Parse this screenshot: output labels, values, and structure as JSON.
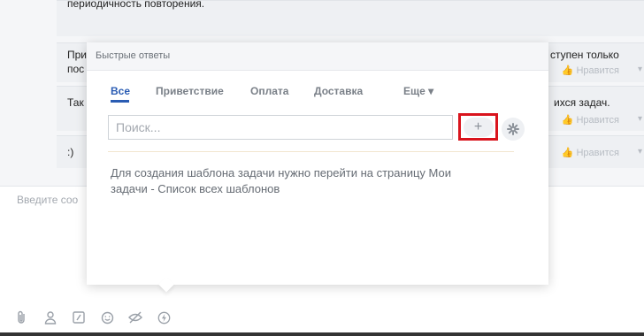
{
  "chat": {
    "msg1_text": "периодичность повторения.",
    "msg2_left": "При",
    "msg2_left2": "пос",
    "msg2_right": "ступен только",
    "msg3_left": "Так",
    "msg3_right": "ихся задач.",
    "msg4_text": ":)",
    "like_label": "Нравится",
    "like_caret": "▾",
    "input_placeholder": "Введите соо"
  },
  "toolbar_icons": [
    "paperclip-icon",
    "person-icon",
    "slash-icon",
    "smile-icon",
    "hidden-eye-icon",
    "lightning-icon"
  ],
  "popup": {
    "title": "Быстрые ответы",
    "tabs": [
      {
        "label": "Все",
        "active": true
      },
      {
        "label": "Приветствие",
        "active": false
      },
      {
        "label": "Оплата",
        "active": false
      },
      {
        "label": "Доставка",
        "active": false
      },
      {
        "label": "Еще ▾",
        "active": false
      }
    ],
    "search_placeholder": "Поиск...",
    "add_label": "+",
    "info_text": "Для создания шаблона задачи нужно перейти на страницу Мои задачи - Список всех шаблонов"
  },
  "colors": {
    "accent": "#2a5cb3",
    "highlight_border": "#d9141d"
  }
}
